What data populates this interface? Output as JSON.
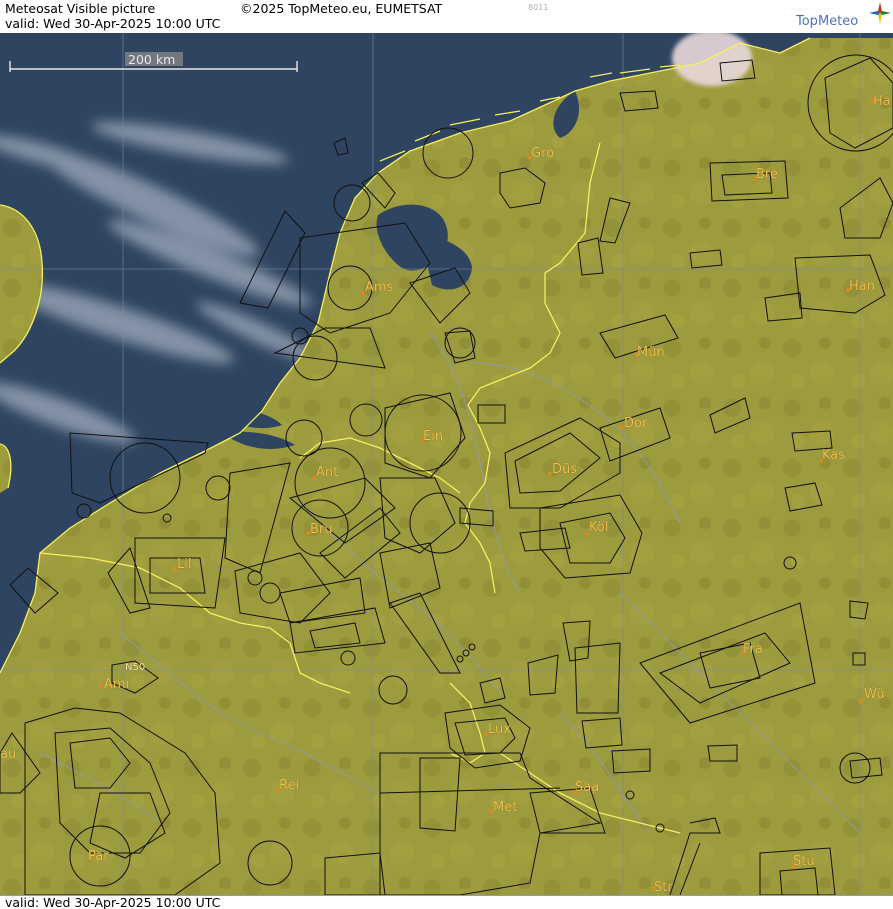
{
  "header": {
    "product": "Meteosat Visible picture",
    "copyright": "©2025 TopMeteo.eu, EUMETSAT",
    "code": "8011",
    "valid": "valid:  Wed  30-Apr-2025  10:00 UTC",
    "brand": "TopMeteo"
  },
  "footer": {
    "valid": "valid:  Wed  30-Apr-2025  10:00 UTC"
  },
  "scale": {
    "label": "200 km"
  },
  "colors": {
    "land": "#9b9a3c",
    "sea": "#2f4461",
    "coast": "#f4f060",
    "border": "#f4f060",
    "airspace": "#111111",
    "grid": "#7d8aa0",
    "label": "#f2c14e"
  },
  "cities": [
    {
      "name": "Gro",
      "id": "gro"
    },
    {
      "name": "Bre",
      "id": "bre"
    },
    {
      "name": "Ha",
      "id": "ha"
    },
    {
      "name": "Ams",
      "id": "ams"
    },
    {
      "name": "Han",
      "id": "han"
    },
    {
      "name": "Mün",
      "id": "mun"
    },
    {
      "name": "Ein",
      "id": "ein"
    },
    {
      "name": "Dor",
      "id": "dor"
    },
    {
      "name": "Kas",
      "id": "kas"
    },
    {
      "name": "Ant",
      "id": "ant"
    },
    {
      "name": "Düs",
      "id": "dus"
    },
    {
      "name": "Bru",
      "id": "bru"
    },
    {
      "name": "Köl",
      "id": "kol"
    },
    {
      "name": "Lil",
      "id": "lil"
    },
    {
      "name": "Fra",
      "id": "fra"
    },
    {
      "name": "Amí",
      "id": "ami"
    },
    {
      "name": "Wü",
      "id": "wu"
    },
    {
      "name": "Lux",
      "id": "lux"
    },
    {
      "name": "Rei",
      "id": "rei"
    },
    {
      "name": "Saa",
      "id": "saa"
    },
    {
      "name": "Met",
      "id": "met"
    },
    {
      "name": "Par",
      "id": "par"
    },
    {
      "name": "Stu",
      "id": "stu"
    },
    {
      "name": "Str",
      "id": "str"
    },
    {
      "name": "au",
      "id": "rou"
    },
    {
      "name": "N50",
      "id": "n50"
    }
  ]
}
